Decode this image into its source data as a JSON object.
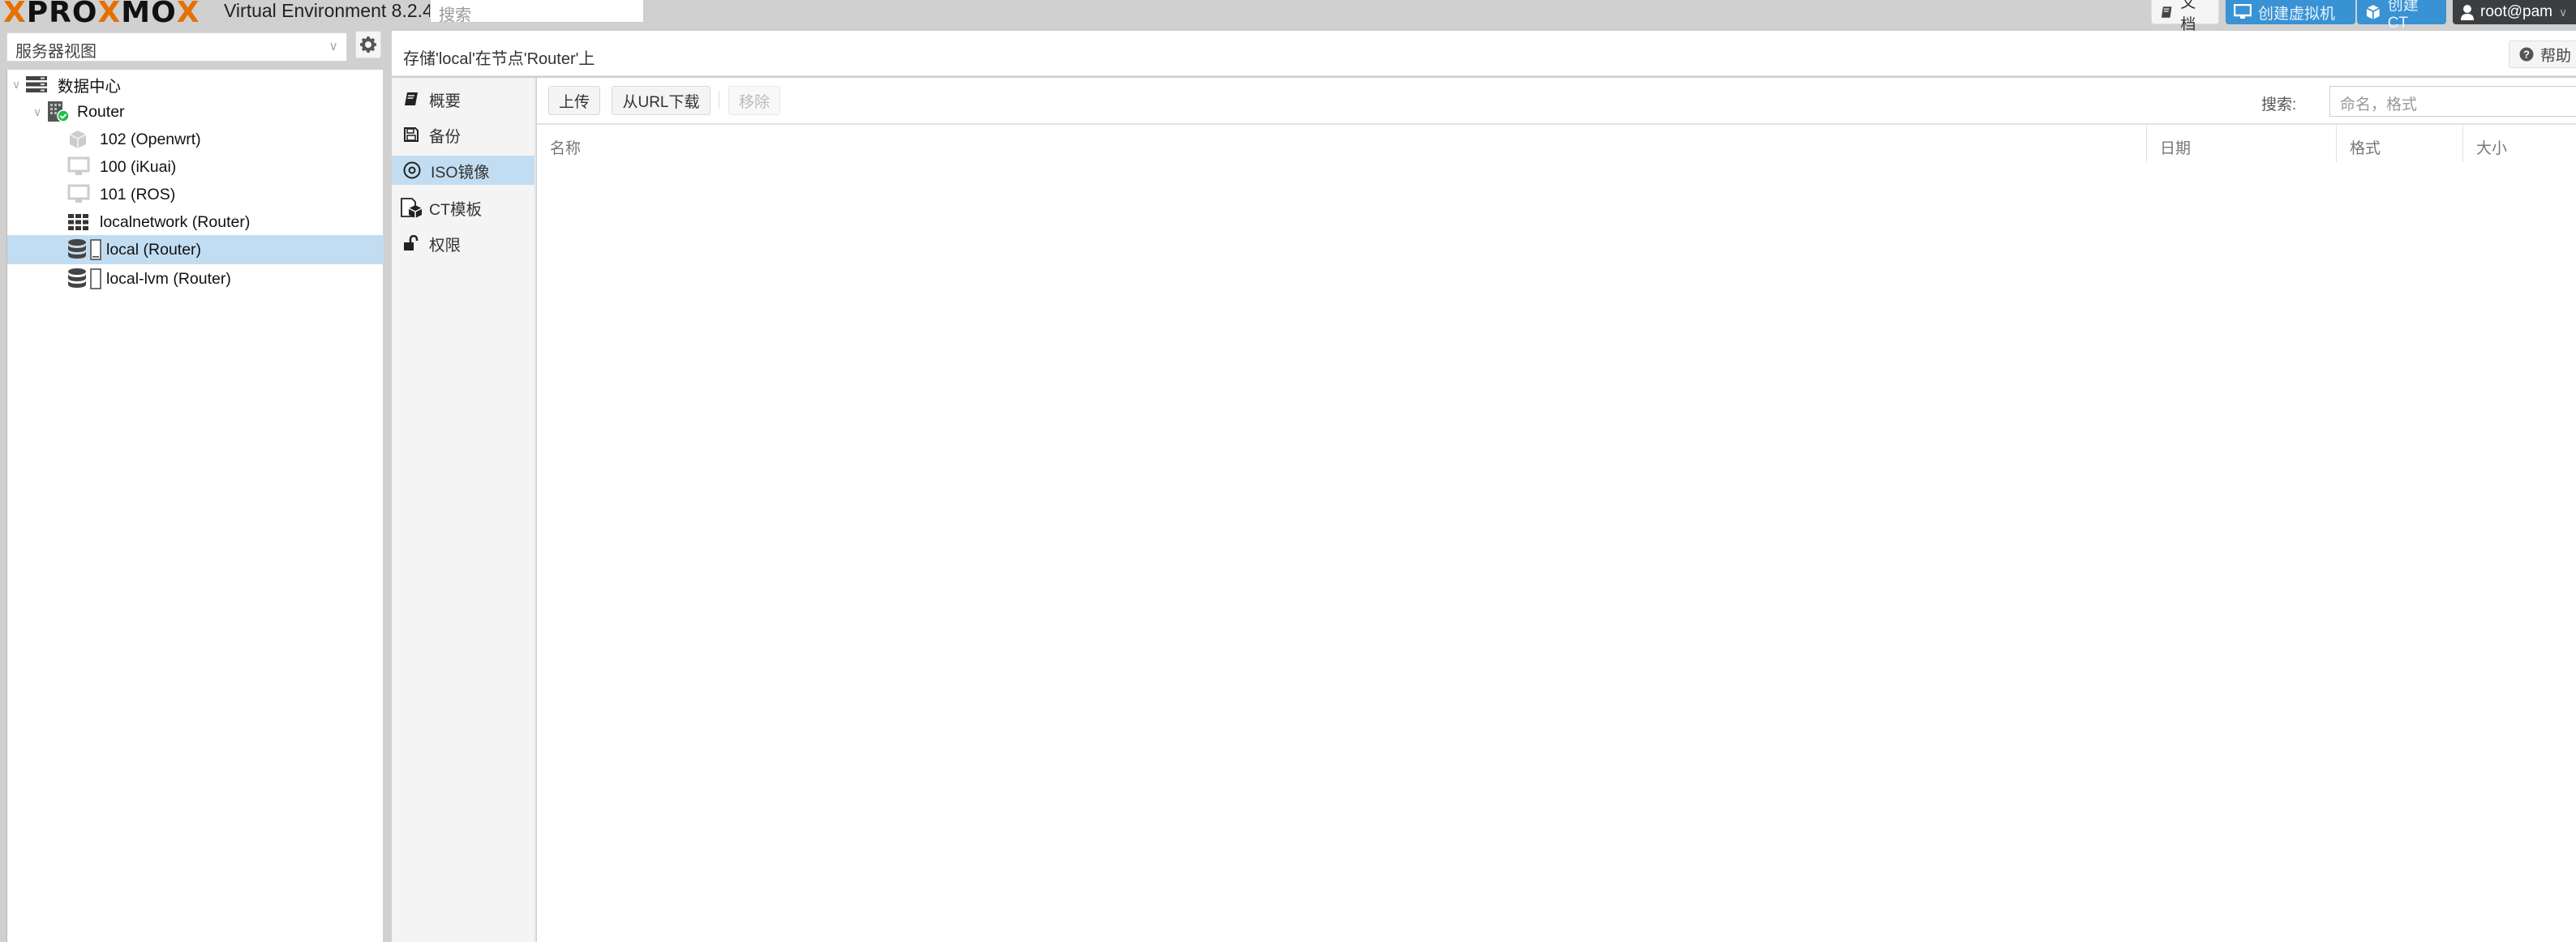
{
  "topbar": {
    "logo_left": "X",
    "logo_mid1": "PRO",
    "logo_x": "X",
    "logo_mid2": "MO",
    "logo_x2": "X",
    "version": "Virtual Environment 8.2.4",
    "search_placeholder": "搜索",
    "docs_label": "文档",
    "create_vm_label": "创建虚拟机",
    "create_ct_label": "创建CT",
    "user_label": "root@pam"
  },
  "left_panel": {
    "view_selector": "服务器视图",
    "tree": [
      {
        "label": "数据中心",
        "icon": "datacenter-icon",
        "level": 0,
        "expanded": true
      },
      {
        "label": "Router",
        "icon": "node-online-icon",
        "level": 1,
        "expanded": true
      },
      {
        "label": "102 (Openwrt)",
        "icon": "container-icon",
        "level": 2
      },
      {
        "label": "100 (iKuai)",
        "icon": "vm-icon",
        "level": 2
      },
      {
        "label": "101 (ROS)",
        "icon": "vm-icon",
        "level": 2
      },
      {
        "label": "localnetwork (Router)",
        "icon": "network-icon",
        "level": 2
      },
      {
        "label": "local (Router)",
        "icon": "storage-icon",
        "level": 2,
        "selected": true
      },
      {
        "label": "local-lvm (Router)",
        "icon": "storage-icon",
        "level": 2
      }
    ]
  },
  "main": {
    "title": "存储'local'在节点'Router'上",
    "help_label": "帮助",
    "nav": [
      {
        "label": "概要",
        "icon": "book-icon"
      },
      {
        "label": "备份",
        "icon": "floppy-icon"
      },
      {
        "label": "ISO镜像",
        "icon": "disc-icon",
        "active": true
      },
      {
        "label": "CT模板",
        "icon": "template-icon"
      },
      {
        "label": "权限",
        "icon": "unlock-icon"
      }
    ],
    "toolbar": {
      "upload_label": "上传",
      "download_url_label": "从URL下载",
      "remove_label": "移除",
      "search_label": "搜索:",
      "search_placeholder": "命名，格式"
    },
    "columns": [
      "名称",
      "日期",
      "格式",
      "大小"
    ],
    "rows": []
  }
}
